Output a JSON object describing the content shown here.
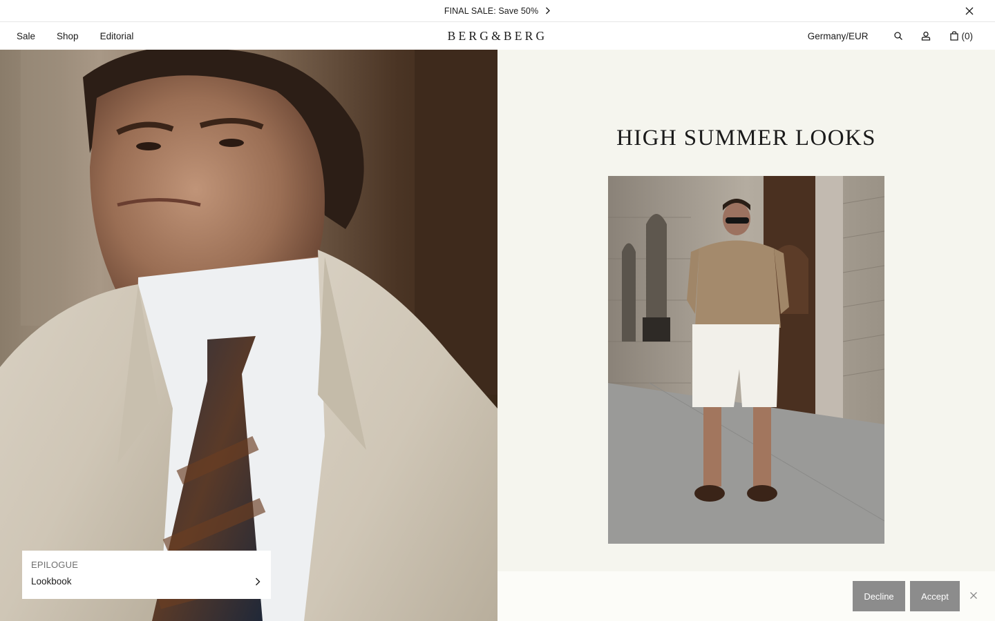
{
  "announcement": {
    "text": "FINAL SALE: Save 50%",
    "arrow_icon": "chevron-right-icon",
    "close_icon": "close-icon"
  },
  "header": {
    "nav": [
      {
        "label": "Sale"
      },
      {
        "label": "Shop"
      },
      {
        "label": "Editorial"
      }
    ],
    "logo": "BERG&BERG",
    "region": "Germany/EUR",
    "search_icon": "search-icon",
    "account_icon": "account-icon",
    "cart_icon": "bag-icon",
    "cart_count": "(0)"
  },
  "hero_left": {
    "card": {
      "eyebrow": "EPILOGUE",
      "title": "Lookbook",
      "arrow_icon": "chevron-right-icon"
    }
  },
  "hero_right": {
    "title": "HIGH SUMMER LOOKS"
  },
  "cookie_bar": {
    "decline_label": "Decline",
    "accept_label": "Accept",
    "close_icon": "close-icon"
  },
  "colors": {
    "background": "#ffffff",
    "panel_cream": "#f5f5ee",
    "cookie_bg": "#fcfcf8",
    "button_grey": "#8c8c8c",
    "text": "#1a1a1a"
  }
}
